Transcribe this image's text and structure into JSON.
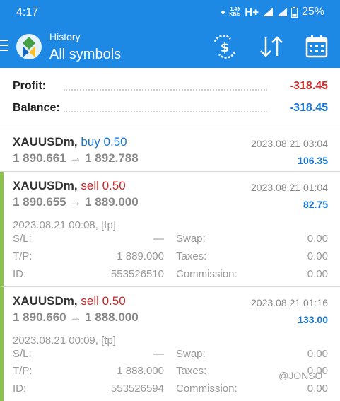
{
  "status": {
    "time": "4:17",
    "speed_top": "1.49",
    "speed_bottom": "KB/s",
    "network": "H+",
    "battery": "25%"
  },
  "toolbar": {
    "subtitle": "History",
    "title": "All symbols",
    "icons": [
      "menu-icon",
      "app-logo",
      "currency-filter-icon",
      "sort-icon",
      "calendar-icon"
    ]
  },
  "summary": {
    "profit_label": "Profit:",
    "profit_value": "-318.45",
    "balance_label": "Balance:",
    "balance_value": "-318.45"
  },
  "trades": [
    {
      "symbol": "XAUUSDm,",
      "type": "buy 0.50",
      "price": "1 890.661 → 1 892.788",
      "time": "2023.08.21 03:04",
      "profit": "106.35"
    },
    {
      "symbol": "XAUUSDm,",
      "type": "sell 0.50",
      "price": "1 890.655 → 1 889.000",
      "time": "2023.08.21 01:04",
      "profit": "82.75",
      "open": "2023.08.21 00:08, [tp]",
      "sl_label": "S/L:",
      "sl": "—",
      "tp_label": "T/P:",
      "tp": "1 889.000",
      "id_label": "ID:",
      "id": "553526510",
      "swap_label": "Swap:",
      "swap": "0.00",
      "taxes_label": "Taxes:",
      "taxes": "0.00",
      "commission_label": "Commission:",
      "commission": "0.00"
    },
    {
      "symbol": "XAUUSDm,",
      "type": "sell 0.50",
      "price": "1 890.660 → 1 888.000",
      "time": "2023.08.21 01:16",
      "profit": "133.00",
      "open": "2023.08.21 00:09, [tp]",
      "sl_label": "S/L:",
      "sl": "—",
      "tp_label": "T/P:",
      "tp": "1 888.000",
      "id_label": "ID:",
      "id": "553526594",
      "swap_label": "Swap:",
      "swap": "0.00",
      "taxes_label": "Taxes:",
      "taxes": "0.00",
      "commission_label": "Commission:",
      "commission": "0.00"
    }
  ],
  "watermark": "@JONSO",
  "colors": {
    "header": "#1e88e5",
    "negative": "#d32f2f",
    "positive": "#1976d2",
    "accent_bar": "#8bc34a"
  }
}
